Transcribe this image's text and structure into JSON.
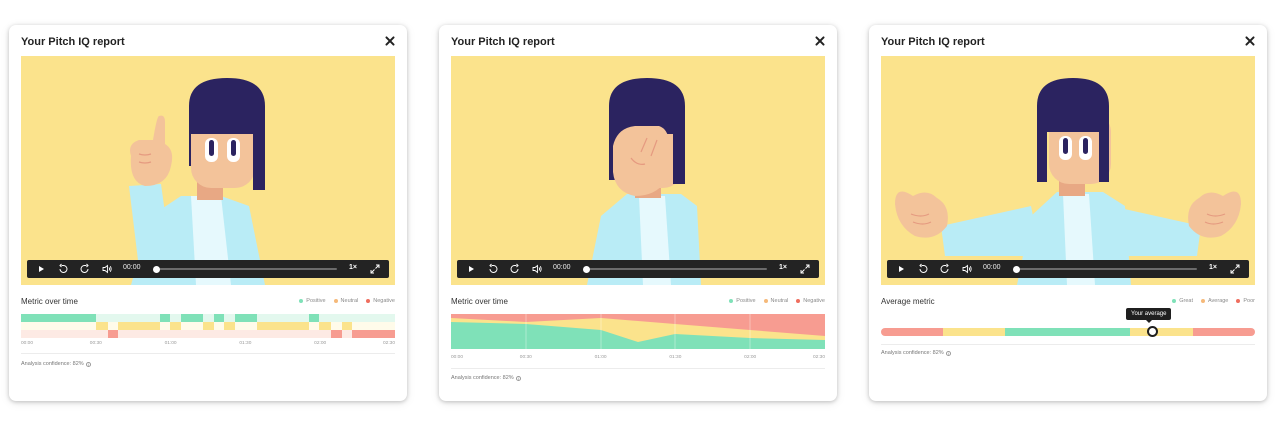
{
  "colors": {
    "positive": "#7fe1b8",
    "neutral": "#fbe38c",
    "negative": "#f79c91",
    "positive_light": "#e3f8ee",
    "negative_light": "#fdeae4",
    "video_bg": "#fbe38c",
    "hair": "#2b2360",
    "skin": "#f3c39a",
    "shirt": "#b9ecf6"
  },
  "cards": [
    {
      "title": "Your Pitch IQ report",
      "player": {
        "time": "00:00",
        "speed": "1×",
        "progress": 0
      },
      "section_title": "Metric over time",
      "legend": [
        "Positive",
        "Neutral",
        "Negative"
      ],
      "axis": [
        "00:00",
        "00:30",
        "01:00",
        "01:30",
        "02:00",
        "02:30"
      ],
      "confidence": "Analysis confidence: 82%"
    },
    {
      "title": "Your Pitch IQ report",
      "player": {
        "time": "00:00",
        "speed": "1×",
        "progress": 0
      },
      "section_title": "Metric over time",
      "legend": [
        "Positive",
        "Neutral",
        "Negative"
      ],
      "axis": [
        "00:00",
        "00:30",
        "01:00",
        "01:30",
        "02:00",
        "02:30"
      ],
      "confidence": "Analysis confidence: 82%"
    },
    {
      "title": "Your Pitch IQ report",
      "player": {
        "time": "00:00",
        "speed": "1×",
        "progress": 0
      },
      "section_title": "Average metric",
      "legend": [
        "Great",
        "Average",
        "Poor"
      ],
      "tooltip": "Your average",
      "average_position": 0.725,
      "confidence": "Analysis confidence: 82%"
    }
  ],
  "icons": [
    "play-icon",
    "rewind-icon",
    "forward-icon",
    "volume-icon",
    "fullscreen-icon",
    "close-icon",
    "info-icon"
  ]
}
